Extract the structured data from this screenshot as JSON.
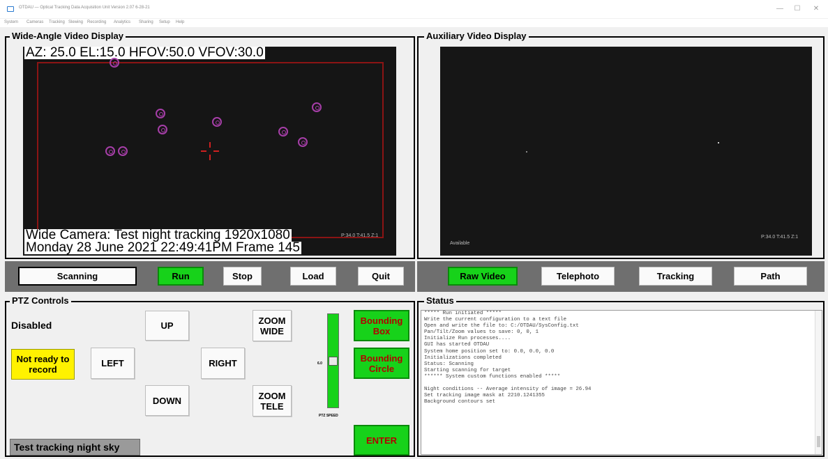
{
  "window": {
    "title": "OTDAU — Optical Tracking Data Acquisition Unit   Version 2.07 6-28-21",
    "min_glyph": "—",
    "max_glyph": "☐",
    "close_glyph": "✕"
  },
  "menu": [
    "System",
    "Cameras",
    "Tracking",
    "Slewing",
    "Recording",
    "Analytics",
    "Sharing",
    "Setup",
    "Help"
  ],
  "wide": {
    "title": "Wide-Angle Video Display",
    "osd_top": "AZ: 25.0  EL:15.0    HFOV:50.0   VFOV:30.0",
    "osd_line1": "Wide Camera: Test night tracking   1920x1080",
    "osd_ptz": "P:34.0 T:41.5 Z:1",
    "osd_line2": "Monday 28 June 2021 22:49:41PM       Frame 145",
    "buttons": {
      "scanning": "Scanning",
      "run": "Run",
      "stop": "Stop",
      "load": "Load",
      "quit": "Quit"
    }
  },
  "aux": {
    "title": "Auxiliary Video Display",
    "available": "Available",
    "ptz": "P:34.0 T:41.5 Z:1",
    "buttons": {
      "raw": "Raw Video",
      "telephoto": "Telephoto",
      "tracking": "Tracking",
      "path": "Path"
    }
  },
  "ptz": {
    "title": "PTZ Controls",
    "state": "Disabled",
    "record_status": "Not ready to record",
    "up": "UP",
    "down": "DOWN",
    "left": "LEFT",
    "right": "RIGHT",
    "zoom_wide": "ZOOM WIDE",
    "zoom_tele": "ZOOM TELE",
    "speed_value": "6.0",
    "speed_label": "PTZ SPEED",
    "speed_fraction": 0.5,
    "bounding_box": "Bounding Box",
    "bounding_circle": "Bounding Circle",
    "enter": "ENTER",
    "session": "Test tracking night sky"
  },
  "status": {
    "title": "Status",
    "lines": [
      "***** Run initiated *****",
      "Write the current configuration to a text file",
      "Open and write the file to: C:/OTDAU/SysConfig.txt",
      "Pan/Tilt/Zoom values to save: 0, 0, 1",
      "Initialize Run processes....",
      "GUI has started OTDAU",
      "System home position set to: 0.0, 0.0, 0.0",
      "Initializations completed",
      "Status: Scanning",
      "Starting scanning for target",
      "****** System custom functions enabled *****",
      "",
      "Night conditions -- Average intensity of image = 26.94",
      "Set tracking image mask at 2210.1241355",
      "Background contours set"
    ]
  },
  "colors": {
    "accent_green": "#17d21a",
    "warning_yellow": "#fff200",
    "roi_red": "#8b1414",
    "target_magenta": "#a63ea8",
    "alert_red_text": "#b30000"
  }
}
